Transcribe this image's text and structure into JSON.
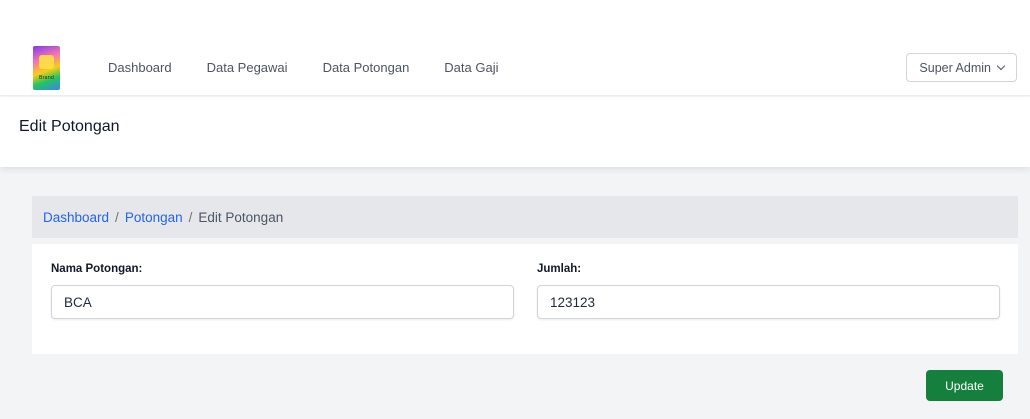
{
  "navbar": {
    "logo_text": "Brand",
    "links": [
      {
        "label": "Dashboard"
      },
      {
        "label": "Data Pegawai"
      },
      {
        "label": "Data Potongan"
      },
      {
        "label": "Data Gaji"
      }
    ],
    "user_menu": {
      "label": "Super Admin",
      "icon": "chevron-down-icon"
    }
  },
  "header": {
    "title": "Edit Potongan"
  },
  "breadcrumb": {
    "items": [
      {
        "label": "Dashboard",
        "link": true
      },
      {
        "label": "Potongan",
        "link": true
      },
      {
        "label": "Edit Potongan",
        "link": false
      }
    ],
    "separator": "/"
  },
  "form": {
    "nama_label": "Nama Potongan:",
    "nama_value": "BCA",
    "jumlah_label": "Jumlah:",
    "jumlah_value": "123123",
    "submit_label": "Update"
  },
  "colors": {
    "link": "#2563eb",
    "primary_button": "#15803d",
    "breadcrumb_bg": "#e5e7eb"
  }
}
